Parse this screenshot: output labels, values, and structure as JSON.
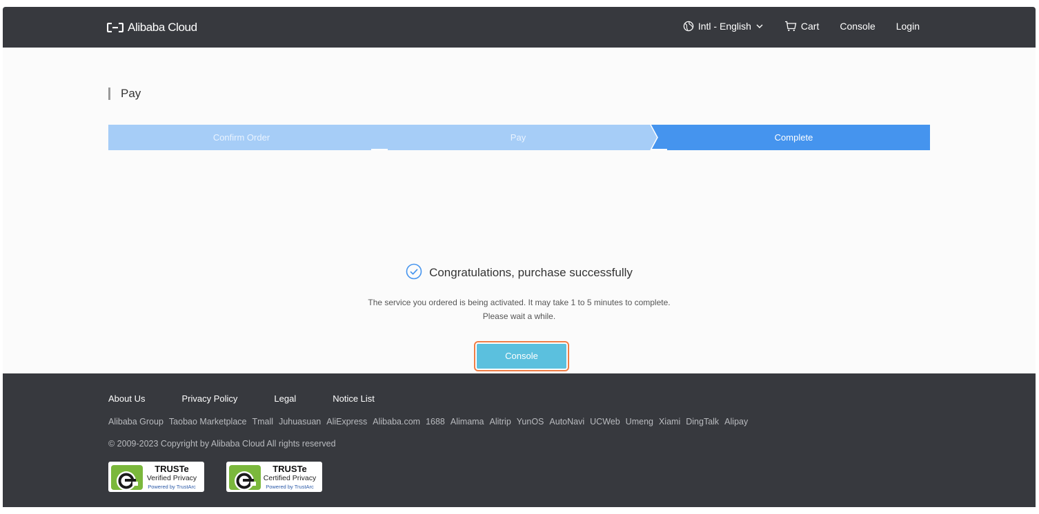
{
  "header": {
    "logo_text": "Alibaba Cloud",
    "language": "Intl - English",
    "cart": "Cart",
    "console": "Console",
    "login": "Login"
  },
  "page": {
    "title": "Pay"
  },
  "steps": [
    {
      "label": "Confirm Order",
      "state": "done"
    },
    {
      "label": "Pay",
      "state": "done"
    },
    {
      "label": "Complete",
      "state": "active"
    }
  ],
  "success": {
    "title": "Congratulations, purchase successfully",
    "message_line1": "The service you ordered is being activated. It may take 1 to 5 minutes to complete.",
    "message_line2": "Please wait a while.",
    "button": "Console"
  },
  "footer": {
    "main_links": [
      "About Us",
      "Privacy Policy",
      "Legal",
      "Notice List"
    ],
    "sub_links": [
      "Alibaba Group",
      "Taobao Marketplace",
      "Tmall",
      "Juhuasuan",
      "AliExpress",
      "Alibaba.com",
      "1688",
      "Alimama",
      "Alitrip",
      "YunOS",
      "AutoNavi",
      "UCWeb",
      "Umeng",
      "Xiami",
      "DingTalk",
      "Alipay"
    ],
    "copyright": "© 2009-2023 Copyright by Alibaba Cloud All rights reserved",
    "badges": [
      {
        "title": "TRUSTe",
        "subtitle": "Verified Privacy",
        "powered": "Powered by TrustArc"
      },
      {
        "title": "TRUSTe",
        "subtitle": "Certified Privacy",
        "powered": "Powered by TrustArc"
      }
    ]
  },
  "colors": {
    "nav_bg": "#37393e",
    "step_done_bg": "#a6cdf7",
    "step_active_bg": "#4594ee",
    "step_done_text": "#e9f3ff",
    "accent_check": "#4594ee",
    "button_bg": "#5bc0de",
    "button_outline": "#ef7d45"
  },
  "icons": {
    "logo": "alibaba-cloud-logo-icon",
    "language": "globe-icon",
    "dropdown": "chevron-down-icon",
    "cart": "cart-icon",
    "success": "check-circle-icon",
    "badge": "truste-seal-icon"
  }
}
